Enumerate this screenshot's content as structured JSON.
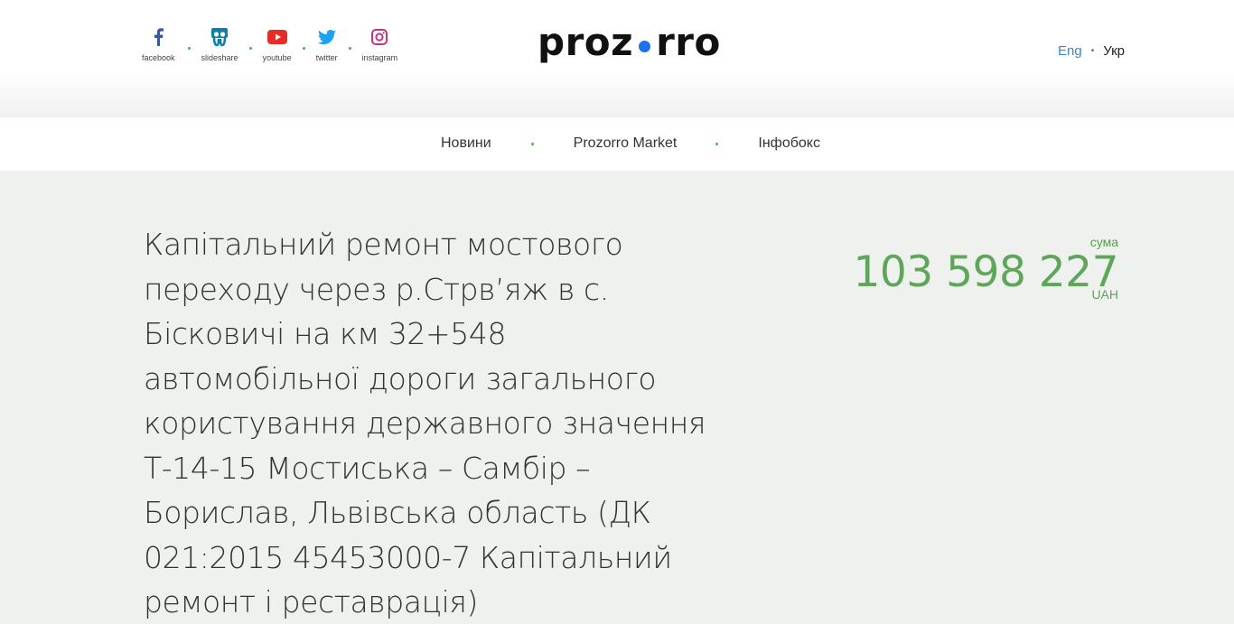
{
  "header": {
    "social": [
      {
        "label": "facebook",
        "icon": "facebook-icon"
      },
      {
        "label": "slideshare",
        "icon": "slideshare-icon"
      },
      {
        "label": "youtube",
        "icon": "youtube-icon"
      },
      {
        "label": "twitter",
        "icon": "twitter-icon"
      },
      {
        "label": "instagram",
        "icon": "instagram-icon"
      }
    ],
    "logo": {
      "left": "proz",
      "right": "rro",
      "dot_color": "#1a73e8"
    },
    "lang": {
      "eng": "Eng",
      "ukr": "Укр",
      "separator": "•"
    }
  },
  "nav": {
    "items": [
      {
        "label": "Новини"
      },
      {
        "label": "Prozorro Market"
      },
      {
        "label": "Інфобокс"
      }
    ]
  },
  "main": {
    "title": "Капітальний ремонт мостового переходу через р.Стрв’яж в с. Бісковичі на км 32+548 автомобільної дороги загального користування державного значення Т-14-15 Мостиська – Самбір – Борислав, Львівська область (ДК 021:2015 45453000-7 Капітальний ремонт і реставрація)",
    "amount": {
      "caption": "сума",
      "value": "103 598 227",
      "currency": "UAH",
      "color": "#5fa55a"
    }
  },
  "colors": {
    "accent_green": "#4caf50",
    "link_blue": "#3a87c9",
    "background": "#eef1ee"
  }
}
